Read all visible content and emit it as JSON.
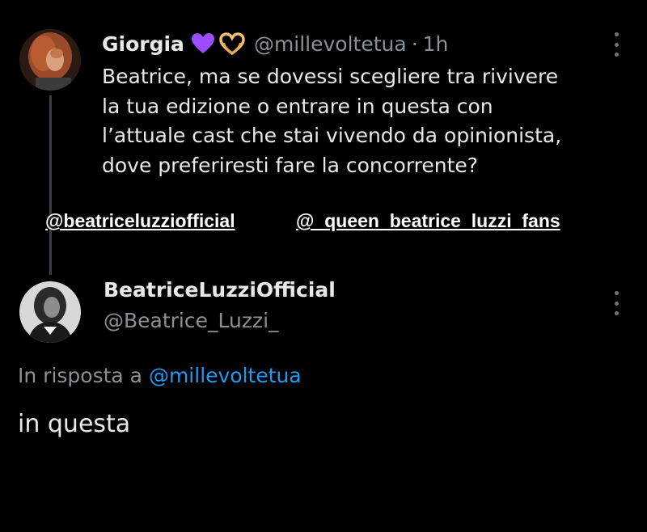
{
  "tweet": {
    "display_name": "Giorgia",
    "emojis": [
      "purple-heart",
      "heart-hands"
    ],
    "handle": "@millevoltetua",
    "separator": "·",
    "time": "1h",
    "lines": [
      "Beatrice, ma se dovessi scegliere tra rivivere",
      "la tua edizione o entrare in questa con",
      "l’attuale cast che stai vivendo da opinionista,",
      "dove preferiresti fare la concorrente?"
    ]
  },
  "overlay": {
    "mention_1": "@beatriceluzziofficial",
    "mention_2": "@_queen_beatrice_luzzi_fans"
  },
  "reply": {
    "display_name": "BeatriceLuzziOfficial",
    "handle": "@Beatrice_Luzzi_",
    "reply_prefix": "In risposta a",
    "reply_to_handle": "@millevoltetua",
    "text": "in questa"
  },
  "colors": {
    "background": "#000000",
    "primary_text": "#e7e9ea",
    "secondary_text": "#8b9096",
    "link": "#1d9bf0",
    "emoji_heart": "#9b4dff"
  },
  "icons": [
    "more-options-icon",
    "purple-heart-emoji",
    "heart-hands-emoji"
  ]
}
